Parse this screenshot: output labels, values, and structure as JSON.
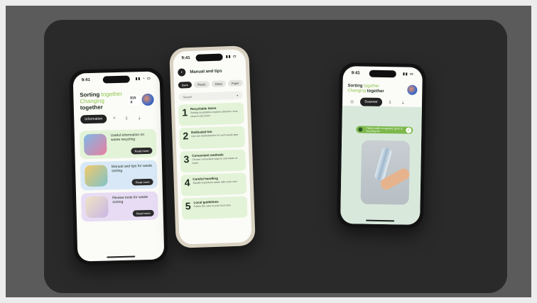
{
  "phone1": {
    "time": "9:41",
    "title_line1_a": "Sorting",
    "title_line1_b": "together",
    "title_line2_a": "Changing",
    "title_line2_b": "together",
    "points": "815 X",
    "segments": [
      "Information",
      "⌗",
      "⇩",
      "⇣"
    ],
    "cards": [
      {
        "text": "Useful information on waste recycling",
        "button": "Read more",
        "bg": "#e3f3d8"
      },
      {
        "text": "Manual and tips for waste sorting",
        "button": "Read more",
        "bg": "#d8e8f6"
      },
      {
        "text": "Review tools for waste sorting",
        "button": "Read more",
        "bg": "#e7dcf3"
      }
    ]
  },
  "phone2": {
    "time": "9:41",
    "title": "Manual and tips",
    "chips": [
      "Back",
      "Plastic",
      "Glass",
      "Paper"
    ],
    "search_placeholder": "Search",
    "tips": [
      {
        "num": "1",
        "title": "Recyclable items",
        "desc": "Sorting recyclables requires attention, from clean to dry items"
      },
      {
        "num": "2",
        "title": "Dedicated bin",
        "desc": "Use one dedicated bin for each waste type"
      },
      {
        "num": "3",
        "title": "Convenient methods",
        "desc": "Choose convenient ways to sort waste at home"
      },
      {
        "num": "4",
        "title": "Careful handling",
        "desc": "Handle hazardous waste with extra care"
      },
      {
        "num": "5",
        "title": "Local guidelines",
        "desc": "Follow the rules in your local area"
      }
    ]
  },
  "phone3": {
    "time": "9:41",
    "title_line1_a": "Sorting",
    "title_line1_b": "together",
    "title_line2_a": "Changing",
    "title_line2_b": "together",
    "segments": [
      "⊙",
      "Scanner",
      "⇩",
      "⇣"
    ],
    "toast": "Plastic bottle recognized, goes to recycling bin",
    "toast_check": "✓"
  }
}
